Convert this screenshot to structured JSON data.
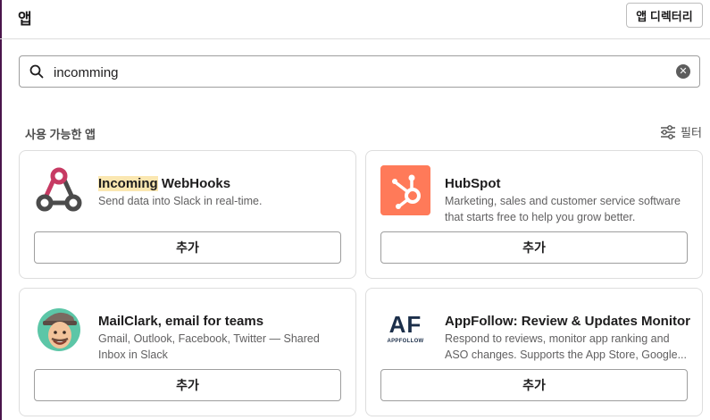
{
  "header": {
    "title": "앱",
    "directory_button": "앱 디렉터리"
  },
  "search": {
    "value": "incomming",
    "placeholder": ""
  },
  "section": {
    "title": "사용 가능한 앱",
    "filter_label": "필터"
  },
  "apps": [
    {
      "name_highlight": "Incoming",
      "name_rest": " WebHooks",
      "description": "Send data into Slack in real-time.",
      "add_label": "추가",
      "icon": "webhook-icon"
    },
    {
      "name": "HubSpot",
      "description": "Marketing, sales and customer service software that starts free to help you grow better.",
      "add_label": "추가",
      "icon": "hubspot-icon",
      "color": "#ff7a59"
    },
    {
      "name": "MailClark, email for teams",
      "description": "Gmail, Outlook, Facebook, Twitter — Shared Inbox in Slack",
      "add_label": "추가",
      "icon": "mailclark-avatar-icon"
    },
    {
      "name": "AppFollow: Review & Updates Monitor",
      "description": "Respond to reviews, monitor app ranking and ASO changes. Supports the App Store, Google...",
      "add_label": "추가",
      "icon": "appfollow-icon",
      "logo_text": "AF",
      "logo_subtext": "APPFOLLOW"
    }
  ],
  "colors": {
    "accent": "#4a154b",
    "highlight": "#fbe7b1"
  }
}
